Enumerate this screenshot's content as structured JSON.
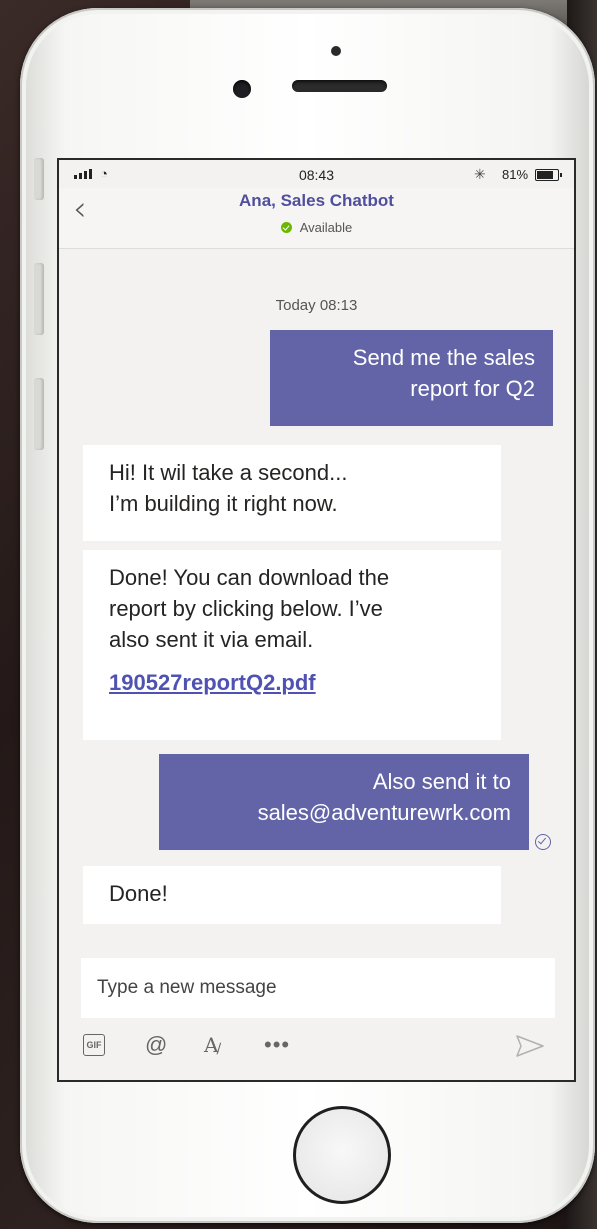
{
  "status_bar": {
    "time": "08:43",
    "battery_pct": "81%",
    "battery_level": 0.81,
    "wifi_icon": "wifi-icon",
    "bluetooth_icon": "bluetooth-icon"
  },
  "header": {
    "title": "Ana, Sales Chatbot",
    "presence": "Available",
    "presence_color": "#6bb700",
    "back_icon": "chevron-left-icon"
  },
  "chat": {
    "date_stamp": "Today 08:13",
    "messages": [
      {
        "from": "me",
        "lines": [
          "Send me the sales",
          "report for Q2"
        ]
      },
      {
        "from": "bot",
        "lines": [
          "Hi! It wil take a second...",
          "I’m building it right now."
        ]
      },
      {
        "from": "bot",
        "lines": [
          "Done! You can download the",
          "report by clicking below. I’ve",
          "also sent it via email."
        ],
        "attachment": "190527reportQ2.pdf"
      },
      {
        "from": "me",
        "lines": [
          "Also send it to",
          "sales@adventurewrk.com"
        ],
        "read_icon": "read-receipt-icon"
      },
      {
        "from": "bot",
        "lines": [
          "Done!"
        ]
      }
    ]
  },
  "composer": {
    "placeholder": "Type a new message"
  },
  "toolbar": {
    "gif_label": "GIF",
    "mention_label": "@",
    "format_label": "A",
    "more_label": "•••",
    "send_icon": "send-icon"
  },
  "colors": {
    "accent": "#6264a7",
    "title": "#4f4f9e",
    "link": "#4f52b2"
  }
}
